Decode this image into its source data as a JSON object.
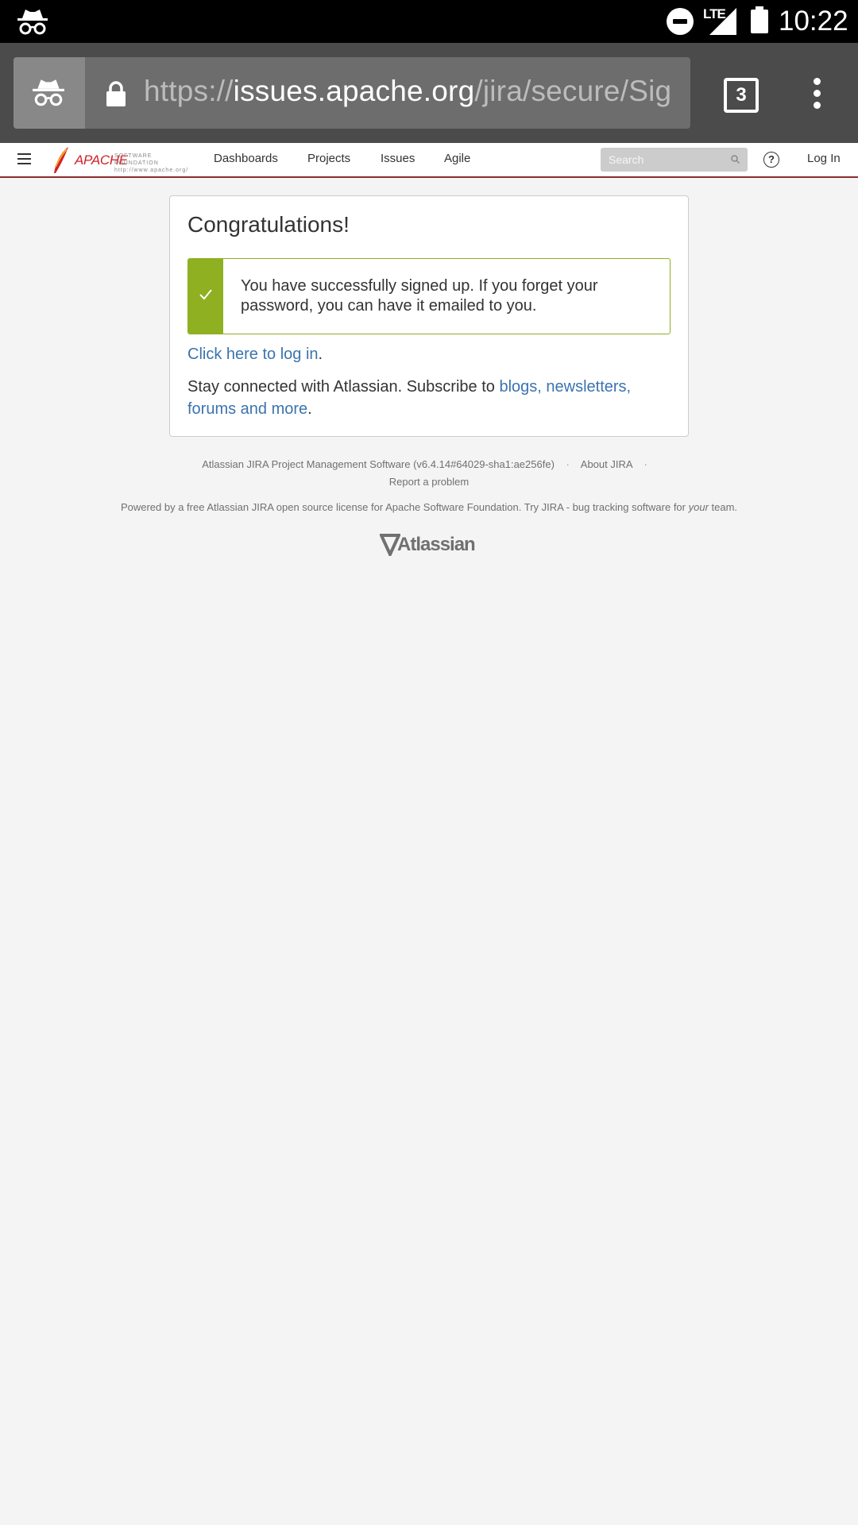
{
  "status_bar": {
    "time": "10:22",
    "network": "LTE",
    "icons": [
      "incognito-icon",
      "do-not-disturb-icon",
      "signal-icon",
      "battery-icon"
    ]
  },
  "browser": {
    "url_scheme": "https://",
    "url_host": "issues.apache.org",
    "url_path": "/jira/secure/Sig",
    "tab_count": "3"
  },
  "header": {
    "logo_text": "APACHE",
    "logo_subtitle_1": "SOFTWARE FOUNDATION",
    "logo_subtitle_2": "http://www.apache.org/",
    "nav": [
      {
        "label": "Dashboards"
      },
      {
        "label": "Projects"
      },
      {
        "label": "Issues"
      },
      {
        "label": "Agile"
      }
    ],
    "search_placeholder": "Search",
    "help_symbol": "?",
    "login_label": "Log In"
  },
  "card": {
    "title": "Congratulations!",
    "message": "You have successfully signed up. If you forget your password, you can have it emailed to you.",
    "login_link": "Click here to log in",
    "login_suffix": ".",
    "stay_prefix": "Stay connected with Atlassian. Subscribe to ",
    "stay_link": "blogs, newsletters, forums and more",
    "stay_suffix": "."
  },
  "footer": {
    "version": "Atlassian JIRA Project Management Software (v6.4.14#64029-sha1:ae256fe)",
    "about": "About JIRA",
    "separator": "·",
    "report": "Report a problem",
    "powered_prefix": "Powered by a free Atlassian JIRA open source license for Apache Software Foundation. Try JIRA - bug tracking software for ",
    "powered_em": "your",
    "powered_suffix": " team.",
    "brand": "Atlassian"
  },
  "colors": {
    "accent_link": "#3b73af",
    "success": "#8eb021",
    "header_border": "#8a2d2d",
    "toolbar": "#4b4b4b"
  }
}
